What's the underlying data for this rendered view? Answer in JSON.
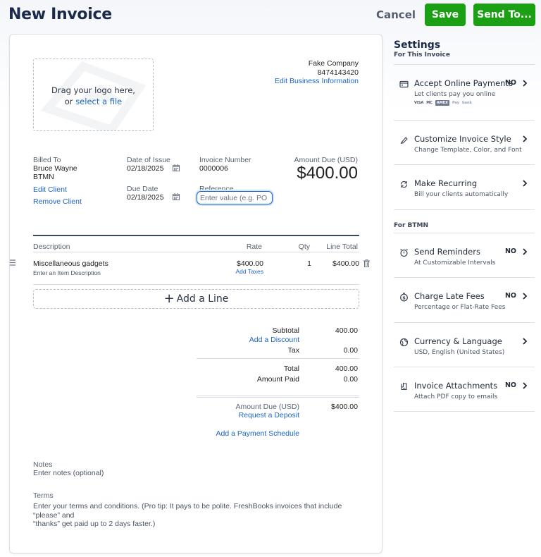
{
  "header": {
    "title": "New Invoice",
    "cancel_label": "Cancel",
    "save_label": "Save",
    "send_label": "Send To..."
  },
  "logo": {
    "line1": "Drag your logo here,",
    "line2_prefix": "or",
    "line2_link": "select a file"
  },
  "business": {
    "name": "Fake Company",
    "phone": "8474143420",
    "edit_link": "Edit Business Information"
  },
  "billing": {
    "billed_to_label": "Billed To",
    "client_name": "Bruce Wayne",
    "client_company": "BTMN",
    "edit_client": "Edit Client",
    "remove_client": "Remove Client",
    "date_issue_label": "Date of Issue",
    "date_issue": "02/18/2025",
    "due_date_label": "Due Date",
    "due_date": "02/18/2025",
    "invoice_number_label": "Invoice Number",
    "invoice_number": "0000006",
    "reference_label": "Reference",
    "reference_placeholder": "Enter value (e.g. PO #)",
    "amount_due_label": "Amount Due (USD)",
    "amount_due": "$400.00"
  },
  "table": {
    "headers": {
      "description": "Description",
      "rate": "Rate",
      "qty": "Qty",
      "line_total": "Line Total"
    },
    "rows": [
      {
        "name": "Miscellaneous gadgets",
        "description_placeholder": "Enter an Item Description",
        "rate": "$400.00",
        "add_taxes": "Add Taxes",
        "qty": "1",
        "line_total": "$400.00"
      }
    ],
    "add_line_label": "Add a Line"
  },
  "totals": {
    "subtotal_label": "Subtotal",
    "subtotal": "400.00",
    "add_discount": "Add a Discount",
    "tax_label": "Tax",
    "tax": "0.00",
    "total_label": "Total",
    "total": "400.00",
    "amount_paid_label": "Amount Paid",
    "amount_paid": "0.00",
    "amount_due_label": "Amount Due (USD)",
    "amount_due": "$400.00",
    "request_deposit": "Request a Deposit",
    "payment_schedule": "Add a Payment Schedule"
  },
  "notes": {
    "label": "Notes",
    "placeholder": "Enter notes (optional)"
  },
  "terms": {
    "label": "Terms",
    "placeholder_line1": "Enter your terms and conditions. (Pro tip: It pays to be polite. FreshBooks invoices that include “please” and",
    "placeholder_line2": "“thanks” get paid up to 2 days faster.)"
  },
  "settings": {
    "title": "Settings",
    "subtitle": "For This Invoice",
    "group_label": "For BTMN",
    "items": [
      {
        "title": "Accept Online Payments",
        "desc": "Let clients pay you online",
        "badge": "NO",
        "icon": "card-icon"
      },
      {
        "title": "Customize Invoice Style",
        "desc": "Change Template, Color, and Font",
        "badge": "",
        "icon": "brush-icon"
      },
      {
        "title": "Make Recurring",
        "desc": "Bill your clients automatically",
        "badge": "",
        "icon": "refresh-icon"
      },
      {
        "title": "Send Reminders",
        "desc": "At Customizable Intervals",
        "badge": "NO",
        "icon": "alarm-icon"
      },
      {
        "title": "Charge Late Fees",
        "desc": "Percentage or Flat-Rate Fees",
        "badge": "NO",
        "icon": "dollar-timer-icon"
      },
      {
        "title": "Currency & Language",
        "desc": "USD, English (United States)",
        "badge": "",
        "icon": "globe-icon"
      },
      {
        "title": "Invoice Attachments",
        "desc": "Attach PDF copy to emails",
        "badge": "NO",
        "icon": "paperclip-icon"
      }
    ],
    "pay_logos": [
      "VISA",
      "MC",
      "AMEX",
      "Pay",
      "bank"
    ]
  },
  "colors": {
    "brand_green": "#1aa012",
    "link_blue": "#1a66c4",
    "title_navy": "#1b2a4a"
  }
}
